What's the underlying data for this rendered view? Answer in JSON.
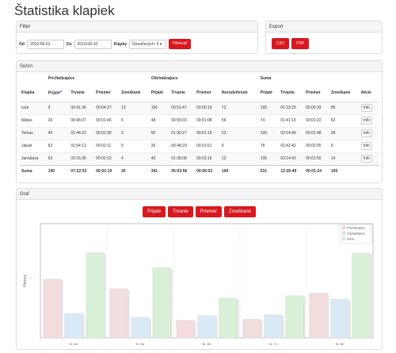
{
  "page": {
    "title": "Štatistika klapiek"
  },
  "filter": {
    "heading": "Filter",
    "from_label": "Od",
    "from_value": "2019-06-01",
    "to_label": "Do",
    "to_value": "2019-06-10",
    "klapky_label": "Klapky",
    "klapky_selected": "Označených: 5",
    "submit_label": "Filtrovať"
  },
  "export": {
    "heading": "Export",
    "csv_label": "CSV",
    "pdf_label": "PDF"
  },
  "summary": {
    "heading": "Súhrn",
    "groups": {
      "incoming": "Prichádzajúce",
      "outgoing": "Odchádzajúce",
      "sum": "Suma"
    },
    "columns": {
      "klapka": "Klapka",
      "prijate": "Prijaté",
      "trvanie": "Trvanie",
      "priemer": "Priemer",
      "zmeskane": "Zmeškané",
      "prijate2": "Prijaté",
      "trvanie2": "Trvanie",
      "priemer2": "Priemer",
      "nezodvihnute": "Nezodvihnuté",
      "prijate3": "Prijaté",
      "trvanie3": "Trvanie",
      "priemer3": "Priemer",
      "zmeskane3": "Zmeškané",
      "akcie": "Akcie"
    },
    "rows": [
      {
        "name": "Ivan",
        "c": [
          "9",
          "00:41:36",
          "00:04:37",
          "13",
          "156",
          "00:51:47",
          "00:00:19",
          "72",
          "165",
          "01:33:23",
          "00:00:33",
          "85"
        ]
      },
      {
        "name": "Matus",
        "c": [
          "26",
          "00:46:07",
          "00:01:46",
          "6",
          "48",
          "00:55:03",
          "00:01:08",
          "56",
          "74",
          "01:41:10",
          "00:01:22",
          "62"
        ]
      },
      {
        "name": "Tomas",
        "c": [
          "40",
          "01:44:22",
          "00:02:36",
          "3",
          "60",
          "01:30:27",
          "00:01:19",
          "23",
          "100",
          "03:14:49",
          "00:01:48",
          "28"
        ]
      },
      {
        "name": "Jakub",
        "c": [
          "52",
          "01:54:13",
          "00:02:11",
          "0",
          "26",
          "00:48:29",
          "00:01:51",
          "6",
          "78",
          "02:42:42",
          "00:02:05",
          "6"
        ]
      },
      {
        "name": "Jaroslava",
        "c": [
          "63",
          "02:16:35",
          "00:02:10",
          "4",
          "43",
          "01:38:08",
          "00:02:16",
          "12",
          "106",
          "03:14:43",
          "00:01:50",
          "14"
        ]
      }
    ],
    "info_label": "Info",
    "total": {
      "name": "Suma",
      "c": [
        "190",
        "07:22:53",
        "00:02:19",
        "26",
        "341",
        "05:03:56",
        "00:00:53",
        "169",
        "531",
        "12:26:49",
        "00:01:24",
        "195"
      ]
    }
  },
  "graph": {
    "heading": "Graf",
    "buttons": [
      "Prijaté",
      "Trvanie",
      "Priemer",
      "Zmeškané"
    ]
  },
  "chart_data": {
    "type": "bar",
    "categories": [
      "Kl. 81",
      "Kl. 84",
      "Kl. 69",
      "Kl. 71",
      "Kl. 82"
    ],
    "series": [
      {
        "name": "Prichádzajúce",
        "color": "#f2dcde",
        "values": [
          134,
          112,
          40,
          43,
          102
        ]
      },
      {
        "name": "Odchádzajúce",
        "color": "#d9e9f5",
        "values": [
          56,
          47,
          51,
          53,
          88
        ]
      },
      {
        "name": "Suma",
        "color": "#d9efd7",
        "values": [
          194,
          160,
          91,
          96,
          193
        ]
      }
    ],
    "ylabel": "Hovory",
    "ylim": [
      0,
      260
    ],
    "legend": "top-right"
  }
}
